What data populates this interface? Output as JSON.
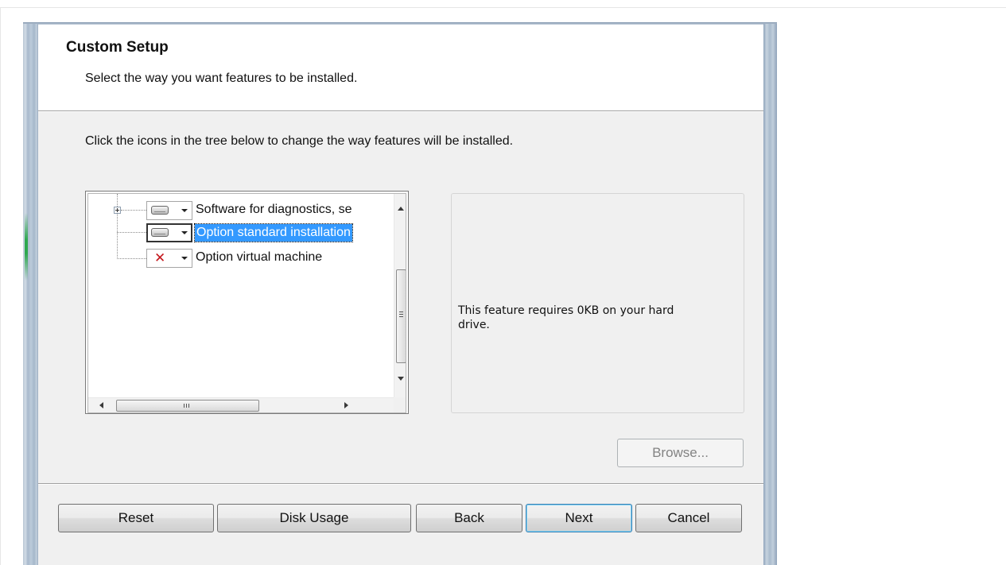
{
  "header": {
    "title": "Custom Setup",
    "subtitle": "Select the way you want features to be installed."
  },
  "instruction": "Click the icons in the tree below to change the way features will be installed.",
  "tree": {
    "items": [
      {
        "label": "Software for diagnostics, se",
        "icon": "hard-drive-icon",
        "state": "install-local",
        "expandable": true,
        "selected": false
      },
      {
        "label": "Option standard installation",
        "icon": "hard-drive-icon",
        "state": "install-local",
        "expandable": false,
        "selected": true
      },
      {
        "label": "Option virtual machine",
        "icon": "red-x-icon",
        "state": "not-installed",
        "expandable": false,
        "selected": false
      }
    ]
  },
  "description": {
    "text": "This feature requires 0KB on your hard drive."
  },
  "buttons": {
    "browse": "Browse...",
    "reset": "Reset",
    "disk_usage": "Disk Usage",
    "back": "Back",
    "next": "Next",
    "cancel": "Cancel"
  },
  "colors": {
    "selection": "#3399ff",
    "dialog_background": "#f0f0f0",
    "red_x": "#c4161c"
  }
}
